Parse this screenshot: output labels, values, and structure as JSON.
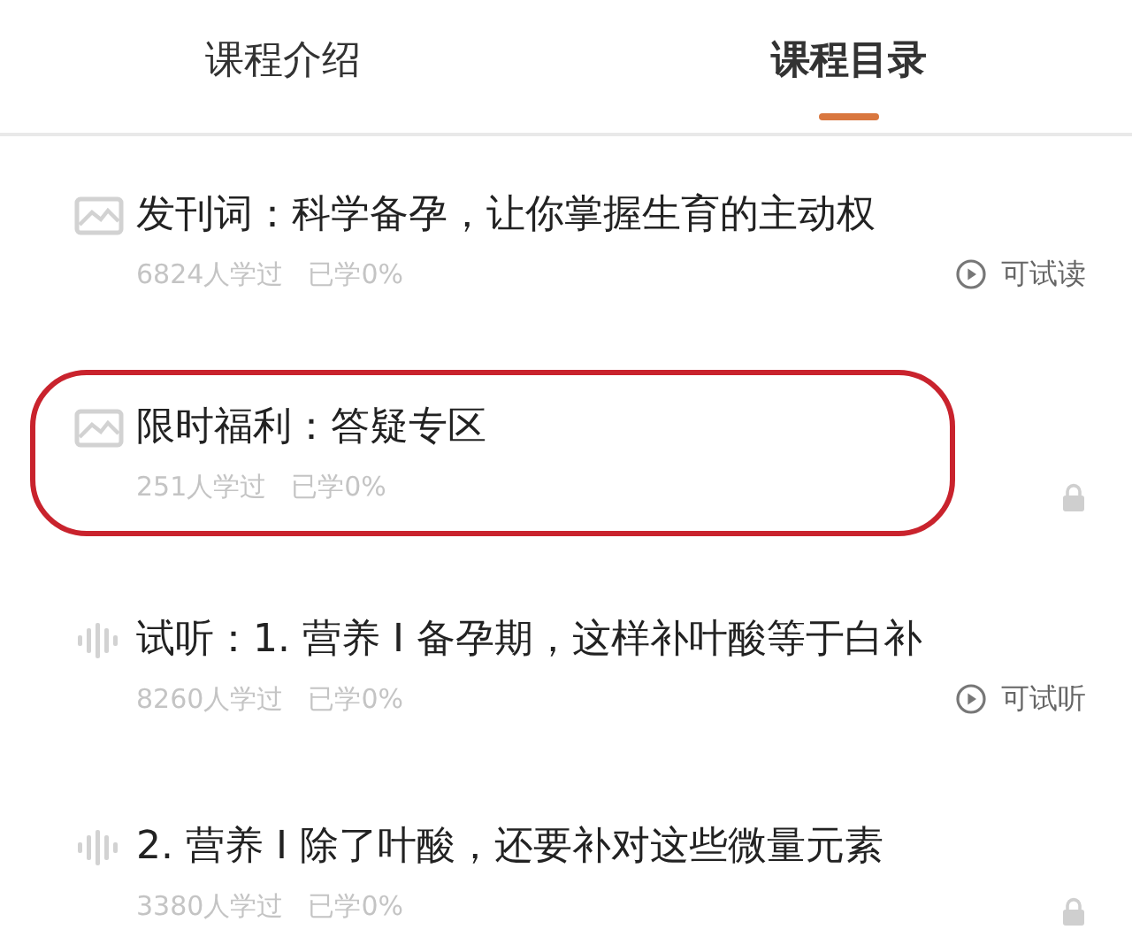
{
  "tabs": [
    {
      "label": "课程介绍",
      "selected": false
    },
    {
      "label": "课程目录",
      "selected": true
    }
  ],
  "lessons": [
    {
      "kind": "article",
      "title": "发刊词：科学备孕，让你掌握生育的主动权",
      "learners": "6824人学过",
      "progress": "已学0%",
      "highlighted": false,
      "locked": false,
      "access_label": "可试读"
    },
    {
      "kind": "article",
      "title": "限时福利：答疑专区",
      "learners": "251人学过",
      "progress": "已学0%",
      "highlighted": true,
      "locked": true
    },
    {
      "kind": "audio",
      "title": "试听：1. 营养 I 备孕期，这样补叶酸等于白补",
      "learners": "8260人学过",
      "progress": "已学0%",
      "highlighted": false,
      "locked": false,
      "access_label": "可试听"
    },
    {
      "kind": "audio",
      "title": "2. 营养 I 除了叶酸，还要补对这些微量元素",
      "learners": "3380人学过",
      "progress": "已学0%",
      "highlighted": false,
      "locked": true
    }
  ]
}
